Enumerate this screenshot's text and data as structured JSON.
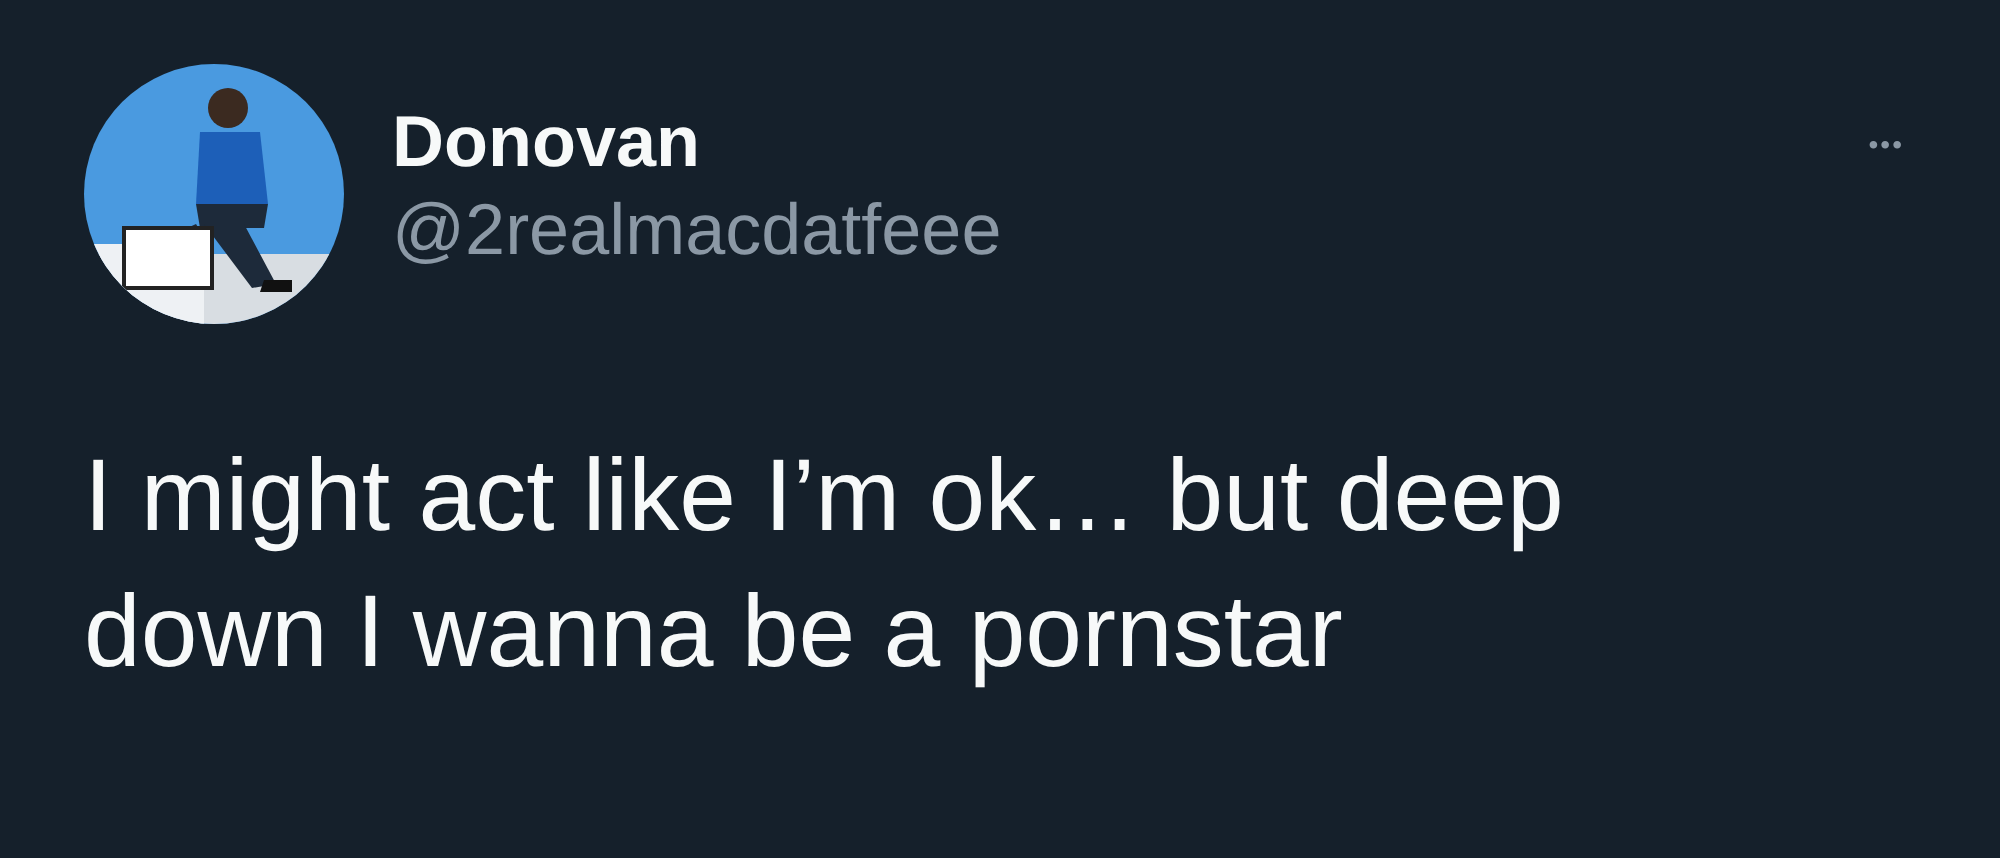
{
  "tweet": {
    "name": "Donovan",
    "handle": "@2realmacdatfeee",
    "more": "•••",
    "text": "I might act like I’m ok… but deep down I wanna be a pornstar"
  }
}
